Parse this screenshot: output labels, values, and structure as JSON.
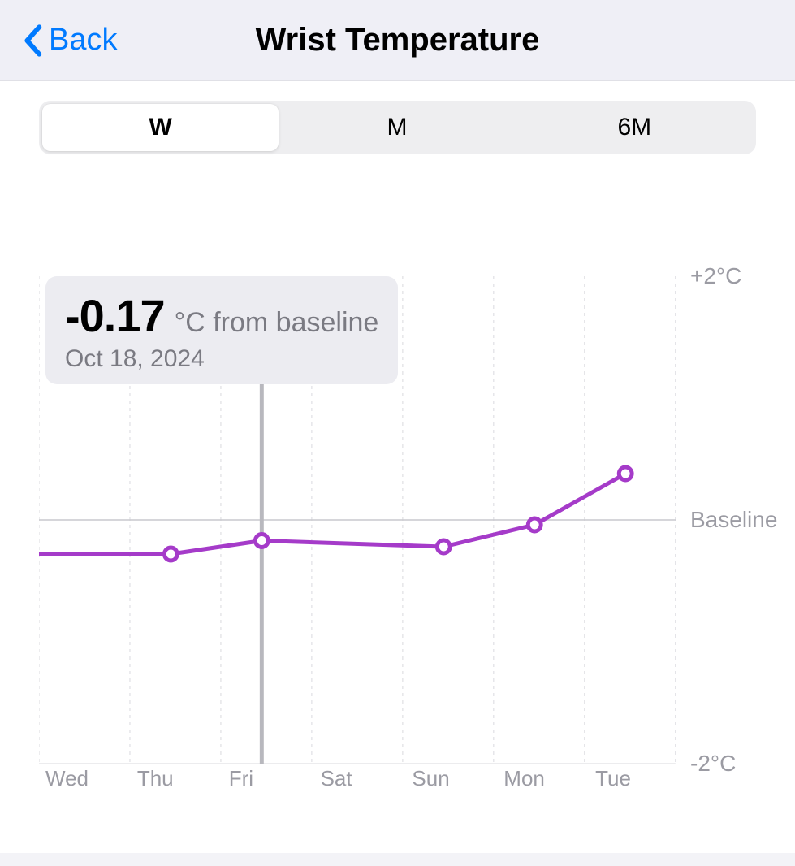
{
  "header": {
    "back_label": "Back",
    "title": "Wrist Temperature"
  },
  "segments": {
    "items": [
      {
        "label": "W",
        "selected": true
      },
      {
        "label": "M",
        "selected": false
      },
      {
        "label": "6M",
        "selected": false
      }
    ]
  },
  "tooltip": {
    "value": "-0.17",
    "unit": "°C from baseline",
    "date": "Oct 18, 2024"
  },
  "chart_data": {
    "type": "line",
    "categories": [
      "Wed",
      "Thu",
      "Fri",
      "Sat",
      "Sun",
      "Mon",
      "Tue"
    ],
    "values": [
      null,
      -0.28,
      -0.17,
      null,
      -0.22,
      -0.04,
      0.38
    ],
    "title": "Wrist Temperature",
    "xlabel": "",
    "ylabel": "°C from baseline",
    "ylim": [
      -2,
      2
    ],
    "y_ticks": [
      {
        "v": 2,
        "label": "+2°C"
      },
      {
        "v": 0,
        "label": "Baseline"
      },
      {
        "v": -2,
        "label": "-2°C"
      }
    ],
    "highlight_index": 2,
    "series_color": "#a53bc9"
  }
}
